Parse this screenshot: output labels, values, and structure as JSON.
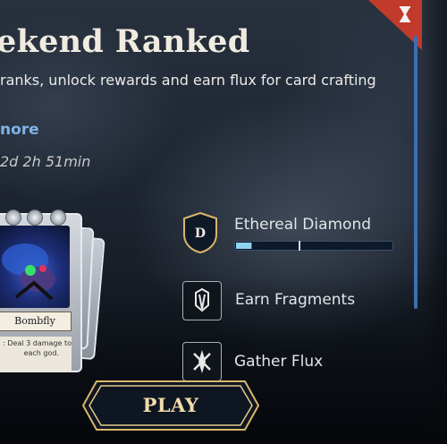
{
  "event": {
    "title": "ekend Ranked",
    "subtitle": "ranks, unlock rewards and earn flux for card crafting",
    "more_link": "nore",
    "timer": "2d 2h 51min"
  },
  "card": {
    "name": "Bombfly",
    "text_line1": ": Deal 3 damage to",
    "text_line2": "each god."
  },
  "rewards": [
    {
      "label": "Ethereal Diamond",
      "emblem_letter": "D",
      "icon": "rank-diamond-shield-icon",
      "progress": 0.1
    },
    {
      "label": "Earn Fragments",
      "icon": "fragments-icon"
    },
    {
      "label": "Gather Flux",
      "icon": "flux-icon"
    }
  ],
  "play_button": {
    "label": "PLAY"
  },
  "icons": {
    "corner": "hourglass-icon"
  },
  "colors": {
    "accent_red": "#c23a2b",
    "link_blue": "#7fb3e8",
    "gold": "#d9b66a",
    "progress_fill": "#8fd3ef"
  }
}
